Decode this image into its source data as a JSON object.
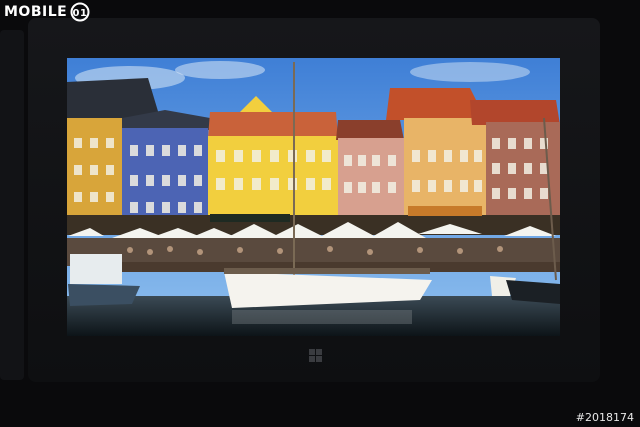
{
  "watermark": {
    "text": "MOBILE",
    "logo_glyph": "01"
  },
  "photo_id": "#2018174",
  "device": {
    "windows_button_icon": "windows-logo-icon"
  }
}
